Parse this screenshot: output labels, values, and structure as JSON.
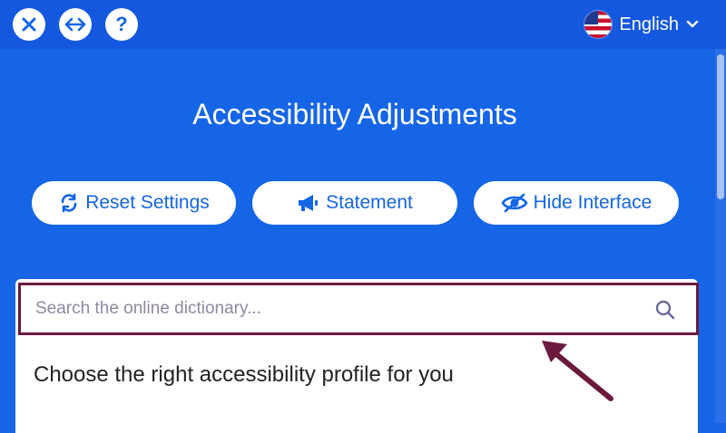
{
  "header": {
    "language_label": "English",
    "flag": "us-flag",
    "buttons": [
      {
        "icon": "close-icon"
      },
      {
        "icon": "resize-horizontal-icon"
      },
      {
        "icon": "help-icon"
      }
    ]
  },
  "main": {
    "title": "Accessibility Adjustments",
    "actions": {
      "reset_label": "Reset Settings",
      "statement_label": "Statement",
      "hide_label": "Hide Interface"
    }
  },
  "search": {
    "placeholder": "Search the online dictionary..."
  },
  "profiles": {
    "heading": "Choose the right accessibility profile for you"
  },
  "colors": {
    "accent": "#1565e6",
    "highlight_border": "#6b1a3e",
    "annotation_arrow": "#6b1a3e"
  }
}
